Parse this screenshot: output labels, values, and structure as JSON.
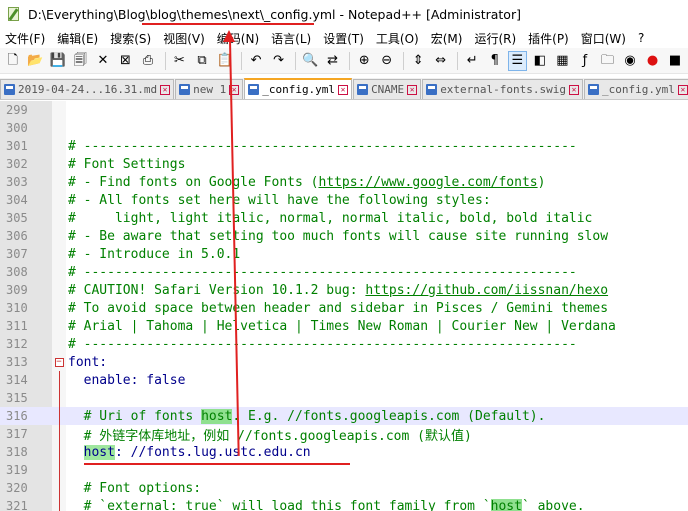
{
  "window": {
    "title": "D:\\Everything\\Blog\\blog\\themes\\next\\_config.yml - Notepad++ [Administrator]"
  },
  "menu": [
    "文件(F)",
    "编辑(E)",
    "搜索(S)",
    "视图(V)",
    "编码(N)",
    "语言(L)",
    "设置(T)",
    "工具(O)",
    "宏(M)",
    "运行(R)",
    "插件(P)",
    "窗口(W)",
    "?"
  ],
  "toolbar": {
    "icons": [
      "new-file-icon",
      "open-file-icon",
      "save-icon",
      "save-all-icon",
      "close-icon",
      "close-all-icon",
      "print-icon",
      "cut-icon",
      "copy-icon",
      "paste-icon",
      "undo-icon",
      "redo-icon",
      "find-icon",
      "replace-icon",
      "zoom-in-icon",
      "zoom-out-icon",
      "sync-v-icon",
      "sync-h-icon",
      "wrap-icon",
      "all-chars-icon",
      "indent-guide-icon",
      "lang-icon",
      "doc-map-icon",
      "func-list-icon",
      "folder-icon",
      "monitor-icon",
      "record-icon",
      "stop-icon"
    ]
  },
  "tabs": [
    {
      "label": "2019-04-24...16.31.md",
      "active": false
    },
    {
      "label": "new 1",
      "active": false
    },
    {
      "label": "_config.yml",
      "active": true
    },
    {
      "label": "CNAME",
      "active": false
    },
    {
      "label": "external-fonts.swig",
      "active": false
    },
    {
      "label": "_config.yml",
      "active": false
    }
  ],
  "editor": {
    "lines": [
      {
        "num": "299",
        "text": ""
      },
      {
        "num": "300",
        "text": ""
      },
      {
        "num": "301",
        "text": "# ---------------------------------------------------------------"
      },
      {
        "num": "302",
        "text": "# Font Settings"
      },
      {
        "num": "303",
        "pre": "# - Find fonts on Google Fonts (",
        "url": "https://www.google.com/fonts",
        "post": ")"
      },
      {
        "num": "304",
        "text": "# - All fonts set here will have the following styles:"
      },
      {
        "num": "305",
        "text": "#     light, light italic, normal, normal italic, bold, bold italic"
      },
      {
        "num": "306",
        "text": "# - Be aware that setting too much fonts will cause site running slow"
      },
      {
        "num": "307",
        "text": "# - Introduce in 5.0.1"
      },
      {
        "num": "308",
        "text": "# ---------------------------------------------------------------"
      },
      {
        "num": "309",
        "pre": "# CAUTION! Safari Version 10.1.2 bug: ",
        "url": "https://github.com/iissnan/hexo",
        "post": ""
      },
      {
        "num": "310",
        "text": "# To avoid space between header and sidebar in Pisces / Gemini themes"
      },
      {
        "num": "311",
        "text": "# Arial | Tahoma | Helvetica | Times New Roman | Courier New | Verdana"
      },
      {
        "num": "312",
        "text": "# ---------------------------------------------------------------"
      },
      {
        "num": "313",
        "key": "font:",
        "fold": "box"
      },
      {
        "num": "314",
        "indent": "  ",
        "key": "enable:",
        "value": " false"
      },
      {
        "num": "315",
        "text": ""
      },
      {
        "num": "316",
        "pre": "  # Uri of fonts ",
        "hl": "host",
        "post": ". E.g. //fonts.googleapis.com (Default).",
        "current": true
      },
      {
        "num": "317",
        "text": "  # 外链字体库地址，例如 //fonts.googleapis.com (默认值)"
      },
      {
        "num": "318",
        "indent": "  ",
        "keyhl": "host",
        "key2": ":",
        "value": " //fonts.lug.ustc.edu.cn"
      },
      {
        "num": "319",
        "text": ""
      },
      {
        "num": "320",
        "text": "  # Font options:"
      },
      {
        "num": "321",
        "pre": "  # `external: true` will load this font family from `",
        "hl": "host",
        "post": "` above."
      }
    ]
  },
  "colors": {
    "annotation_red": "#e02020",
    "comment_green": "#008000",
    "key_blue": "#00008b",
    "highlight_green": "#8fe08f",
    "tab_active_orange": "#f5a623"
  }
}
